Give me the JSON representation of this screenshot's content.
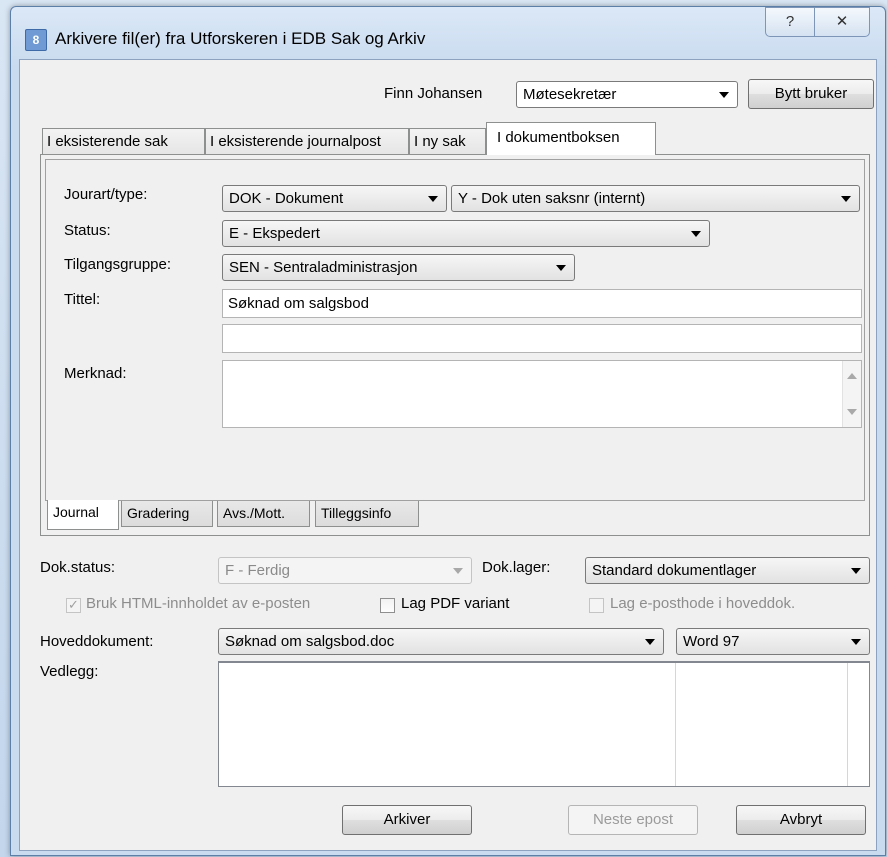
{
  "window": {
    "title": "Arkivere fil(er) fra Utforskeren i EDB Sak og Arkiv",
    "app_icon_text": "8",
    "help_glyph": "?",
    "close_glyph": "✕"
  },
  "user": {
    "name": "Finn Johansen",
    "role": "Møtesekretær",
    "switch_button": "Bytt  bruker"
  },
  "tabs": [
    {
      "label": "I eksisterende sak",
      "active": false
    },
    {
      "label": "I eksisterende journalpost",
      "active": false
    },
    {
      "label": "I ny sak",
      "active": false
    },
    {
      "label": "I dokumentboksen",
      "active": true
    }
  ],
  "form": {
    "jourart_label": "Jourart/type:",
    "jourart_value": "DOK - Dokument",
    "type_value": "Y - Dok uten saksnr (internt)",
    "status_label": "Status:",
    "status_value": "E - Ekspedert",
    "tilgang_label": "Tilgangsgruppe:",
    "tilgang_value": "SEN - Sentraladministrasjon",
    "tittel_label": "Tittel:",
    "tittel_value": "Søknad om salgsbod",
    "tittel2_value": "",
    "merknad_label": "Merknad:",
    "merknad_value": ""
  },
  "bottom_tabs": [
    {
      "label": "Journal",
      "active": true
    },
    {
      "label": "Gradering",
      "active": false
    },
    {
      "label": "Avs./Mott.",
      "active": false
    },
    {
      "label": "Tilleggsinfo",
      "active": false
    }
  ],
  "doc": {
    "status_label": "Dok.status:",
    "status_value": "F - Ferdig",
    "lager_label": "Dok.lager:",
    "lager_value": "Standard dokumentlager",
    "html_checkbox_label": "Bruk HTML-innholdet av e-posten",
    "html_checkbox_mark": "✓",
    "pdf_checkbox_label": "Lag PDF variant",
    "header_checkbox_label": "Lag e-posthode i hoveddok.",
    "hoved_label": "Hoveddokument:",
    "hoved_value": "Søknad om salgsbod.doc",
    "format_value": "Word 97",
    "vedlegg_label": "Vedlegg:"
  },
  "buttons": {
    "arkiver": "Arkiver",
    "neste": "Neste epost",
    "avbryt": "Avbryt"
  }
}
